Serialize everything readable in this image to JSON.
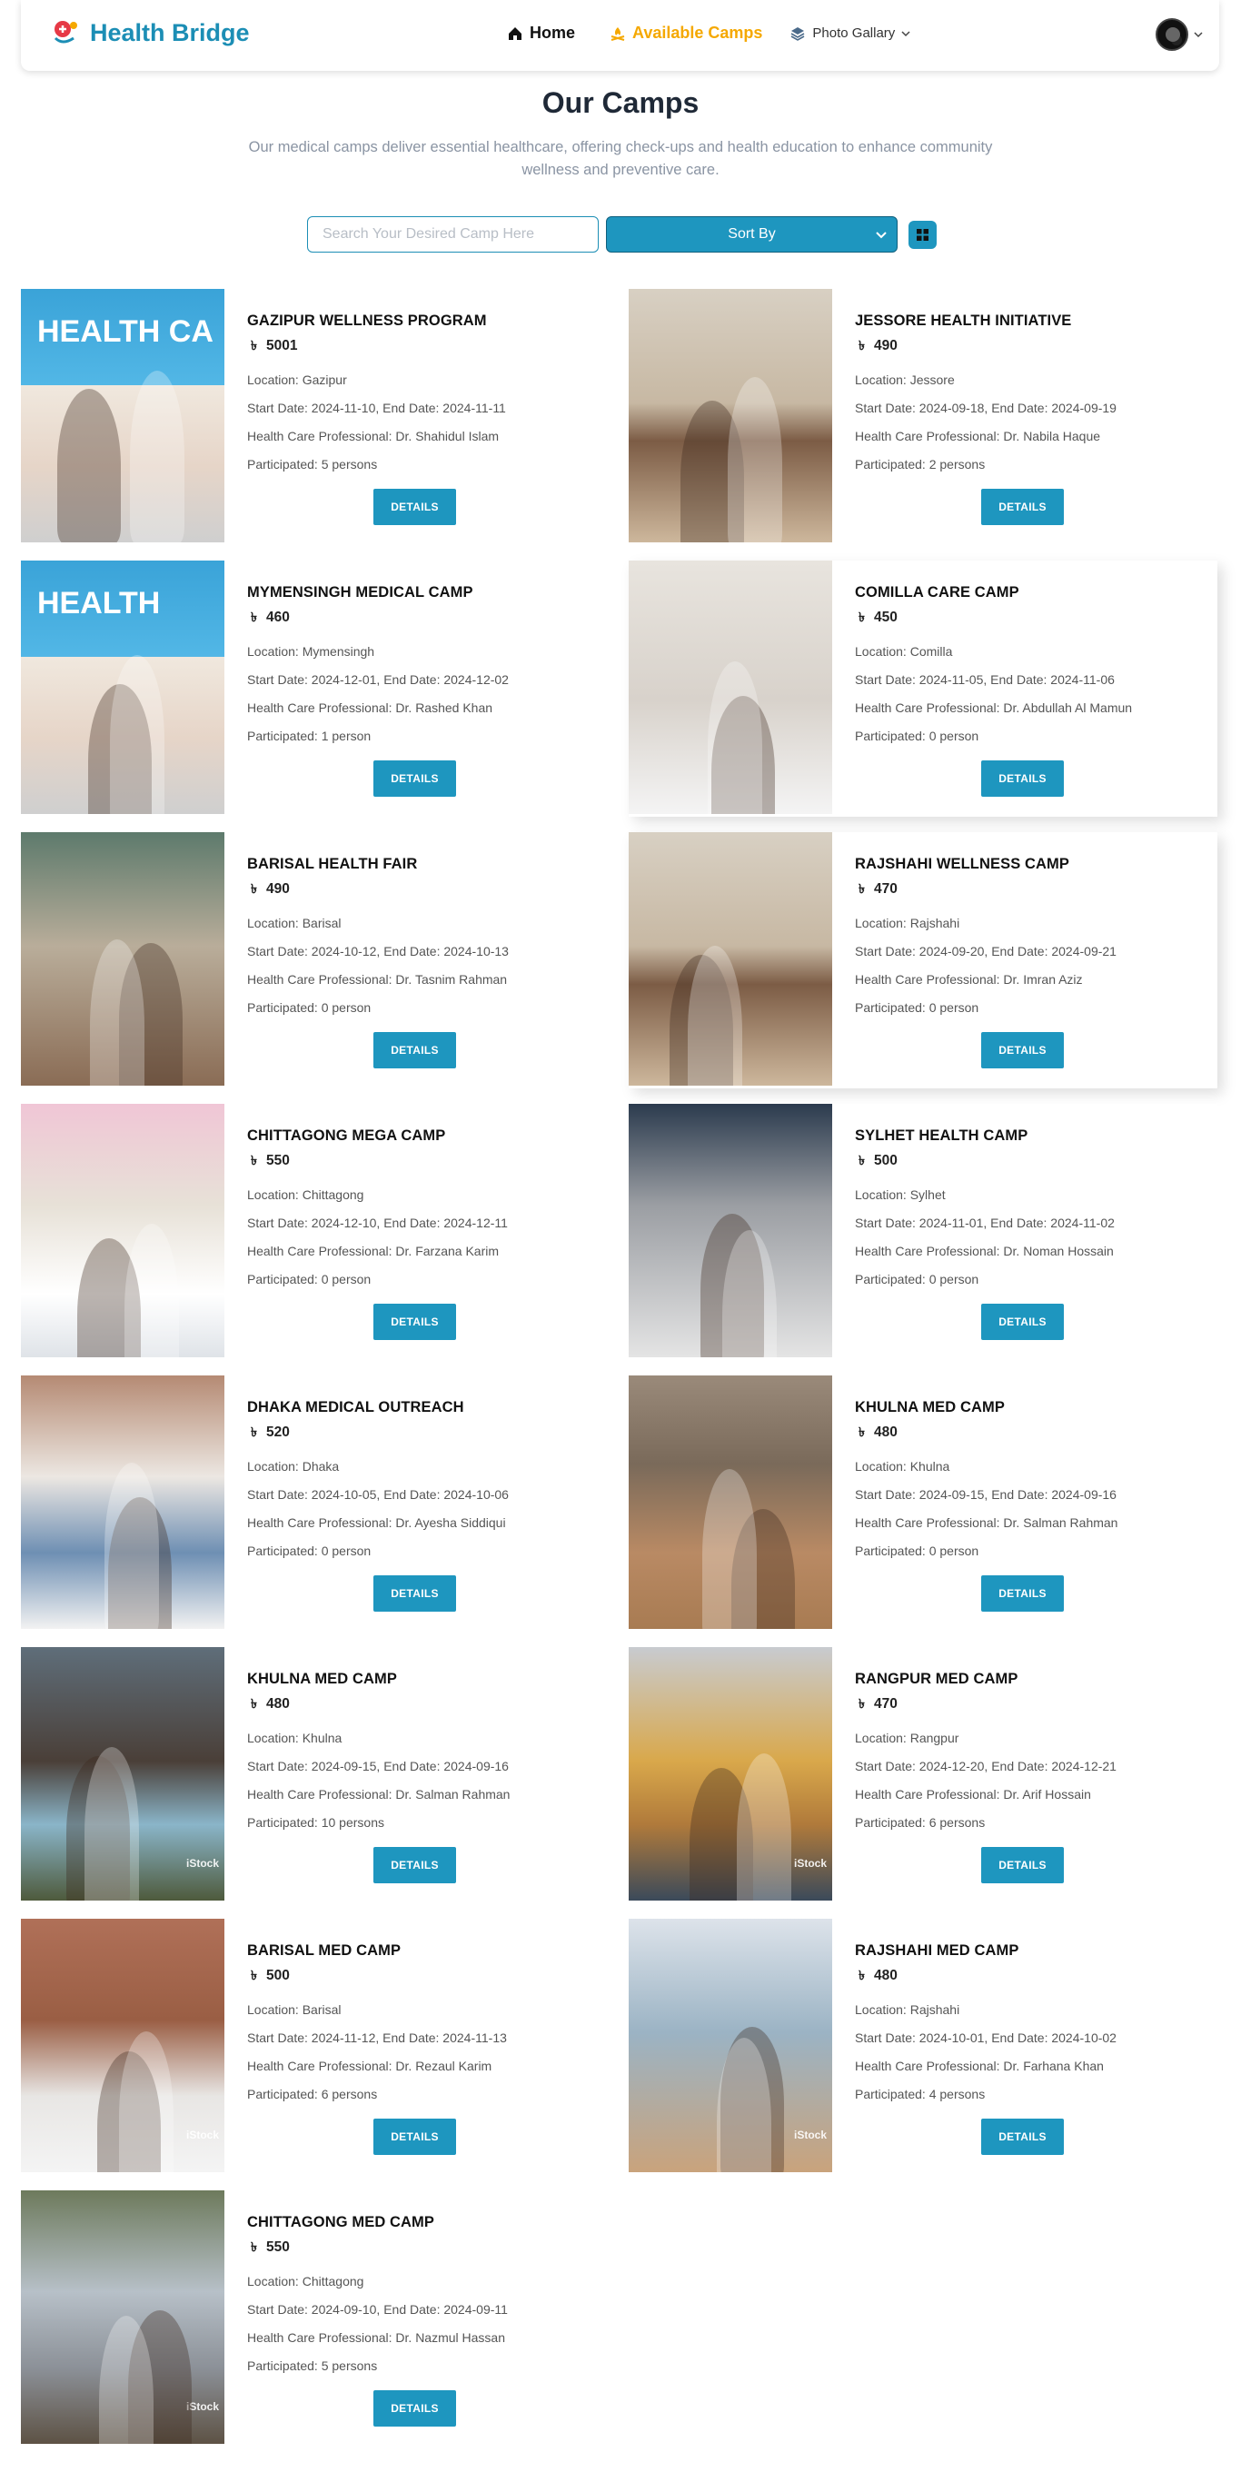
{
  "nav": {
    "brand": "Health Bridge",
    "home_label": "Home",
    "camps_label": "Available Camps",
    "gallery_label": "Photo Gallary"
  },
  "hero": {
    "title": "Our Camps",
    "subtitle": "Our medical camps deliver essential healthcare, offering check-ups and health education to enhance community wellness and preventive care."
  },
  "controls": {
    "search_placeholder": "Search Your Desired Camp Here",
    "sort_label": "Sort By"
  },
  "icons": {
    "home": "home-icon",
    "camps": "campfire-icon",
    "gallery": "layers-icon",
    "layout": "grid-icon",
    "currency": "taka-icon"
  },
  "colors": {
    "brand": "#1c8eb5",
    "accent_nav": "#f5a800",
    "button": "#1e96bf"
  },
  "details_label": "DETAILS",
  "camps": [
    {
      "name": "GAZIPUR WELLNESS PROGRAM",
      "fee": "5001",
      "location": "Location: Gazipur",
      "dates": "Start Date: 2024-11-10, End Date: 2024-11-11",
      "professional": "Health Care Professional: Dr. Shahidul Islam",
      "participated": "Participated: 5 persons",
      "banner": "HEALTH CA"
    },
    {
      "name": "JESSORE HEALTH INITIATIVE",
      "fee": "490",
      "location": "Location: Jessore",
      "dates": "Start Date: 2024-09-18, End Date: 2024-09-19",
      "professional": "Health Care Professional: Dr. Nabila Haque",
      "participated": "Participated: 2 persons"
    },
    {
      "name": "MYMENSINGH MEDICAL CAMP",
      "fee": "460",
      "location": "Location: Mymensingh",
      "dates": "Start Date: 2024-12-01, End Date: 2024-12-02",
      "professional": "Health Care Professional: Dr. Rashed Khan",
      "participated": "Participated: 1 person",
      "banner": "HEALTH"
    },
    {
      "name": "COMILLA CARE CAMP",
      "fee": "450",
      "location": "Location: Comilla",
      "dates": "Start Date: 2024-11-05, End Date: 2024-11-06",
      "professional": "Health Care Professional: Dr. Abdullah Al Mamun",
      "participated": "Participated: 0 person"
    },
    {
      "name": "BARISAL HEALTH FAIR",
      "fee": "490",
      "location": "Location: Barisal",
      "dates": "Start Date: 2024-10-12, End Date: 2024-10-13",
      "professional": "Health Care Professional: Dr. Tasnim Rahman",
      "participated": "Participated: 0 person"
    },
    {
      "name": "RAJSHAHI WELLNESS CAMP",
      "fee": "470",
      "location": "Location: Rajshahi",
      "dates": "Start Date: 2024-09-20, End Date: 2024-09-21",
      "professional": "Health Care Professional: Dr. Imran Aziz",
      "participated": "Participated: 0 person"
    },
    {
      "name": "CHITTAGONG MEGA CAMP",
      "fee": "550",
      "location": "Location: Chittagong",
      "dates": "Start Date: 2024-12-10, End Date: 2024-12-11",
      "professional": "Health Care Professional: Dr. Farzana Karim",
      "participated": "Participated: 0 person"
    },
    {
      "name": "SYLHET HEALTH CAMP",
      "fee": "500",
      "location": "Location: Sylhet",
      "dates": "Start Date: 2024-11-01, End Date: 2024-11-02",
      "professional": "Health Care Professional: Dr. Noman Hossain",
      "participated": "Participated: 0 person"
    },
    {
      "name": "DHAKA MEDICAL OUTREACH",
      "fee": "520",
      "location": "Location: Dhaka",
      "dates": "Start Date: 2024-10-05, End Date: 2024-10-06",
      "professional": "Health Care Professional: Dr. Ayesha Siddiqui",
      "participated": "Participated: 0 person"
    },
    {
      "name": "KHULNA MED CAMP",
      "fee": "480",
      "location": "Location: Khulna",
      "dates": "Start Date: 2024-09-15, End Date: 2024-09-16",
      "professional": "Health Care Professional: Dr. Salman Rahman",
      "participated": "Participated: 0 person"
    },
    {
      "name": "KHULNA MED CAMP",
      "fee": "480",
      "location": "Location: Khulna",
      "dates": "Start Date: 2024-09-15, End Date: 2024-09-16",
      "professional": "Health Care Professional: Dr. Salman Rahman",
      "participated": "Participated: 10 persons",
      "watermark": "iStock"
    },
    {
      "name": "RANGPUR MED CAMP",
      "fee": "470",
      "location": "Location: Rangpur",
      "dates": "Start Date: 2024-12-20, End Date: 2024-12-21",
      "professional": "Health Care Professional: Dr. Arif Hossain",
      "participated": "Participated: 6 persons",
      "watermark": "iStock"
    },
    {
      "name": "BARISAL MED CAMP",
      "fee": "500",
      "location": "Location: Barisal",
      "dates": "Start Date: 2024-11-12, End Date: 2024-11-13",
      "professional": "Health Care Professional: Dr. Rezaul Karim",
      "participated": "Participated: 6 persons",
      "watermark": "iStock"
    },
    {
      "name": "RAJSHAHI MED CAMP",
      "fee": "480",
      "location": "Location: Rajshahi",
      "dates": "Start Date: 2024-10-01, End Date: 2024-10-02",
      "professional": "Health Care Professional: Dr. Farhana Khan",
      "participated": "Participated: 4 persons",
      "watermark": "iStock"
    },
    {
      "name": "CHITTAGONG MED CAMP",
      "fee": "550",
      "location": "Location: Chittagong",
      "dates": "Start Date: 2024-09-10, End Date: 2024-09-11",
      "professional": "Health Care Professional: Dr. Nazmul Hassan",
      "participated": "Participated: 5 persons",
      "watermark": "iStock"
    }
  ]
}
